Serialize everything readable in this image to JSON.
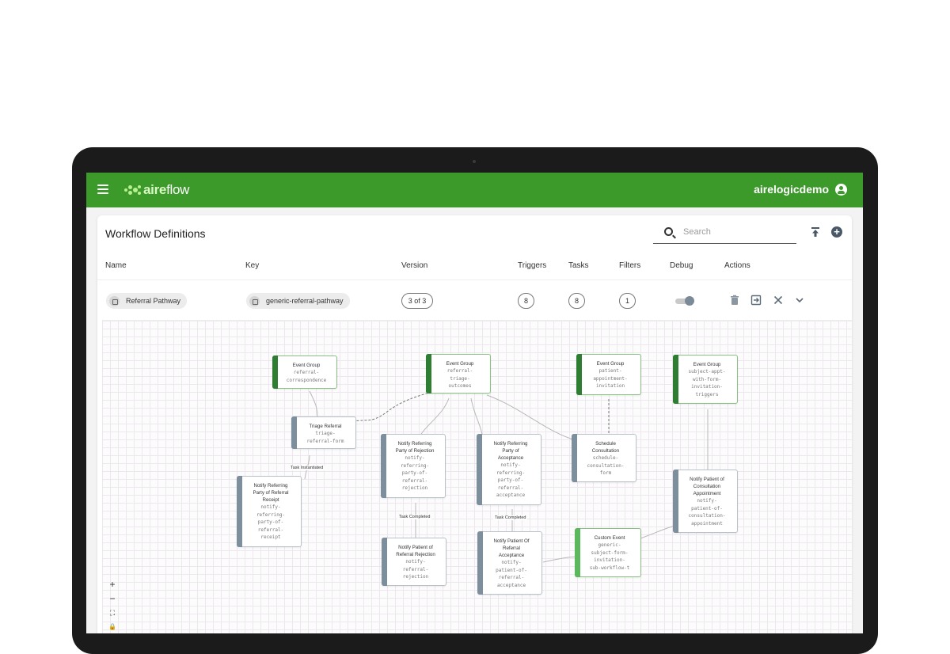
{
  "app": {
    "brand_bold": "aire",
    "brand_light": "flow",
    "username": "airelogicdemo"
  },
  "page": {
    "title": "Workflow Definitions",
    "search_placeholder": "Search"
  },
  "table": {
    "headers": {
      "name": "Name",
      "key": "Key",
      "version": "Version",
      "triggers": "Triggers",
      "tasks": "Tasks",
      "filters": "Filters",
      "debug": "Debug",
      "actions": "Actions"
    },
    "row": {
      "name": "Referral Pathway",
      "key": "generic-referral-pathway",
      "version": "3 of 3",
      "triggers": "8",
      "tasks": "8",
      "filters": "1",
      "debug_enabled": false
    }
  },
  "diagram": {
    "nodes": [
      {
        "id": "eg1",
        "title": "Event Group",
        "key": "referral-\ncorrespondence"
      },
      {
        "id": "eg2",
        "title": "Event Group",
        "key": "referral-\ntriage-\noutcomes"
      },
      {
        "id": "eg3",
        "title": "Event Group",
        "key": "patient-\nappointment-\ninvitation"
      },
      {
        "id": "eg4",
        "title": "Event Group",
        "key": "subject-appt-\nwith-form-\ninvitation-\ntriggers"
      },
      {
        "id": "triage",
        "title": "Triage Referral",
        "key": "triage-\nreferral-form"
      },
      {
        "id": "rejection",
        "title": "Notify Referring\nParty of Rejection",
        "key": "notify-\nreferring-\nparty-of-\nreferral-\nrejection"
      },
      {
        "id": "acceptance",
        "title": "Notify Referring\nParty of\nAcceptance",
        "key": "notify-\nreferring-\nparty-of-\nreferral-\nacceptance"
      },
      {
        "id": "schedule",
        "title": "Schedule\nConsultation",
        "key": "schedule-\nconsultation-\nform"
      },
      {
        "id": "receipt",
        "title": "Notify Referring\nParty of Referral\nReceipt",
        "key": "notify-\nreferring-\nparty-of-\nreferral-\nreceipt"
      },
      {
        "id": "patrej",
        "title": "Notify Patient of\nReferral Rejection",
        "key": "notify-\nreferral-\nrejection"
      },
      {
        "id": "patacc",
        "title": "Notify Patient Of\nReferral\nAcceptance",
        "key": "notify-\npatient-of-\nreferral-\nacceptance"
      },
      {
        "id": "custom",
        "title": "Custom Event",
        "key": "generic-\nsubject-form-\ninvitation-\nsub-workflow-t"
      },
      {
        "id": "consult",
        "title": "Notify Patient of\nConsultation\nAppointment",
        "key": "notify-\npatient-of-\nconsultation-\nappointment"
      }
    ],
    "edge_labels": {
      "task_instantiated": "Task Instantiated",
      "task_completed_1": "Task Completed",
      "task_completed_2": "Task Completed"
    },
    "zoom_controls": [
      "+",
      "−",
      "⛶",
      "🔒"
    ]
  }
}
